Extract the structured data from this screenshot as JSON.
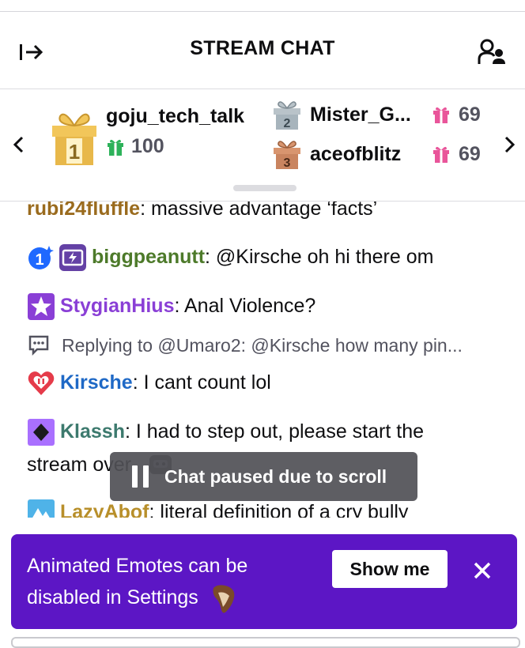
{
  "header": {
    "title": "STREAM CHAT",
    "collapse_icon": "collapse-right-arrow-icon",
    "users_icon": "community-icon"
  },
  "leaderboard": {
    "first": {
      "rank": "1",
      "name": "goju_tech_talk",
      "count": "100"
    },
    "second": {
      "rank": "2",
      "name": "Mister_G...",
      "count": "69"
    },
    "third": {
      "rank": "3",
      "name": "aceofblitz",
      "count": "69"
    },
    "colors": {
      "gold": "#e8b84a",
      "silver": "#a7b4bc",
      "bronze": "#c9845f",
      "green": "#2db25a",
      "pink": "#e9559a"
    }
  },
  "chat": {
    "messages": [
      {
        "user": "rubi24fluffle",
        "sep": ":",
        "text": " massive advantage ‘facts’",
        "color": "#9a6b1e"
      },
      {
        "user": "biggpeanutt",
        "sep": ":",
        "text": " @Kirsche  oh hi there om",
        "color": "#4d7a2a"
      },
      {
        "user": "StygianHius",
        "sep": ":",
        "text": " Anal Violence?",
        "color": "#8a3fd6"
      },
      {
        "reply": "Replying to @Umaro2: @Kirsche how many pin..."
      },
      {
        "user": "Kirsche",
        "sep": ":",
        "text": " I cant count lol",
        "color": "#1f69c6"
      },
      {
        "user": "Klassh",
        "sep": ":",
        "text": " I had to step out, please start the",
        "text2": "stream over",
        "color": "#3d7a6e"
      },
      {
        "user": "LazyAbof",
        "sep": ":",
        "text": " literal definition of a cry bully",
        "color": "#b88f2a"
      }
    ],
    "badges": {
      "sub_months": "1"
    }
  },
  "paused_notice": {
    "text": "Chat paused due to scroll"
  },
  "banner": {
    "line1": "Animated Emotes can be",
    "line2": "disabled in Settings",
    "button": "Show me",
    "bg": "#5c16c5"
  }
}
